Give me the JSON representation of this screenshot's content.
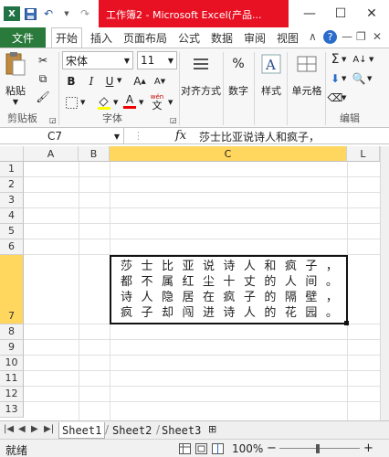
{
  "title": "工作簿2 - Microsoft Excel(产品...",
  "qat": {
    "save": "save-icon",
    "undo": "↶",
    "redo": "↷"
  },
  "window": {
    "minimize": "—",
    "maximize": "☐",
    "close": "✕"
  },
  "tabs": {
    "file": "文件",
    "home": "开始",
    "insert": "插入",
    "layout": "页面布局",
    "formula": "公式",
    "data": "数据",
    "review": "审阅",
    "view": "视图"
  },
  "ribbon": {
    "paste": "粘贴",
    "clipboard": "剪贴板",
    "font_name": "宋体",
    "font_size": "11",
    "bold": "B",
    "italic": "I",
    "underline": "U",
    "grow": "A",
    "shrink": "A",
    "font_group": "字体",
    "align": "对齐方式",
    "number": "数字",
    "style": "样式",
    "cell": "单元格",
    "edit": "编辑",
    "percent": "%",
    "wen": "wén",
    "sigma": "Σ"
  },
  "formula_bar": {
    "name_box": "C7",
    "fx": "fx",
    "content": "莎士比亚说诗人和疯子，"
  },
  "columns": [
    "A",
    "B",
    "C",
    "L"
  ],
  "rows": [
    "1",
    "2",
    "3",
    "4",
    "5",
    "6",
    "7",
    "8",
    "9",
    "10",
    "11",
    "12",
    "13"
  ],
  "cell_c7": {
    "lines": [
      [
        "莎",
        "士",
        "比",
        "亚",
        "说",
        "诗",
        "人",
        "和",
        "疯",
        "子",
        "，"
      ],
      [
        "都",
        "不",
        "属",
        "红",
        "尘",
        "十",
        "丈",
        "的",
        "人",
        "间",
        "。"
      ],
      [
        "诗",
        "人",
        "隐",
        "居",
        "在",
        "疯",
        "子",
        "的",
        "隔",
        "壁",
        "，"
      ],
      [
        "疯",
        "子",
        "却",
        "闯",
        "进",
        "诗",
        "人",
        "的",
        "花",
        "园",
        "。"
      ]
    ]
  },
  "sheets": [
    "Sheet1",
    "Sheet2",
    "Sheet3"
  ],
  "status": {
    "ready": "就绪",
    "zoom": "100%",
    "minus": "−",
    "plus": "+"
  },
  "colors": {
    "file_tab": "#2a7a3b",
    "title_red": "#e81123",
    "selected_header": "#ffd65e"
  }
}
